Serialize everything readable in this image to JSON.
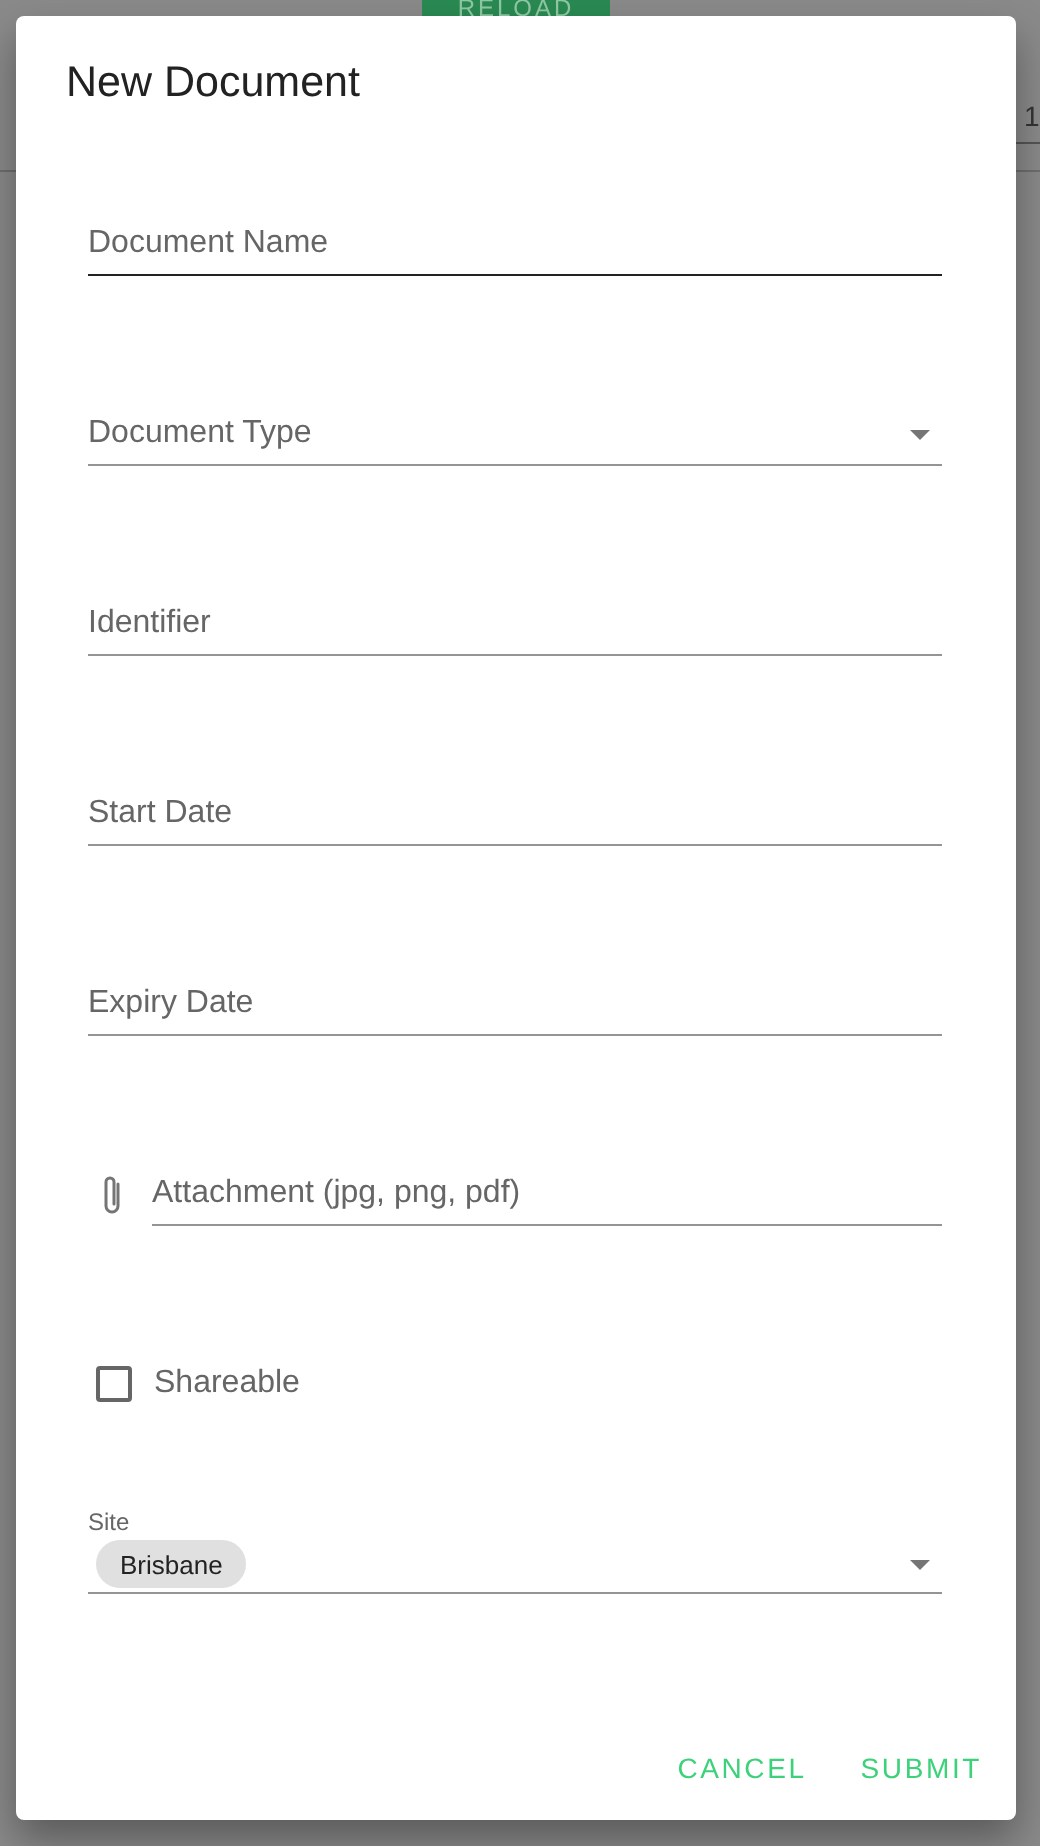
{
  "background": {
    "reload_button": "RELOAD",
    "cell_text": "1"
  },
  "dialog": {
    "title": "New Document",
    "fields": [
      {
        "kind": "text",
        "placeholder": "Document Name",
        "focused": true
      },
      {
        "kind": "select",
        "placeholder": "Document Type",
        "focused": false
      },
      {
        "kind": "text",
        "placeholder": "Identifier",
        "focused": false
      },
      {
        "kind": "text",
        "placeholder": "Start Date",
        "focused": false
      },
      {
        "kind": "text",
        "placeholder": "Expiry Date",
        "focused": false
      },
      {
        "kind": "file",
        "placeholder": "Attachment (jpg, png, pdf)",
        "focused": false
      }
    ],
    "checkbox": {
      "label": "Shareable",
      "checked": false
    },
    "site": {
      "label": "Site",
      "chips": [
        "Brisbane"
      ]
    },
    "buttons": [
      "CANCEL",
      "SUBMIT"
    ]
  }
}
